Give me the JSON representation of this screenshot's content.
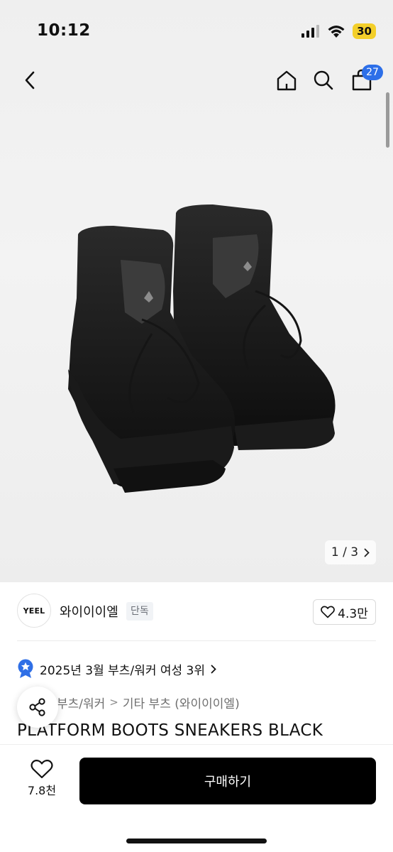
{
  "status_bar": {
    "time": "10:12",
    "battery": "30",
    "battery_color": "#f3cf2a"
  },
  "top_nav": {
    "icons": [
      "back-chevron-icon",
      "home-icon",
      "search-icon",
      "shopping-bag-icon"
    ],
    "cart_count": "27",
    "badge_color": "#2d6fe8"
  },
  "gallery": {
    "current": "1 / 3",
    "image_subject": "black high-top lace-up platform sneaker boots"
  },
  "brand": {
    "logo_text": "YEEL",
    "name": "와이이이엘",
    "badge": "단독",
    "likes": "4.3만"
  },
  "ranking": {
    "icon": "star-badge-icon",
    "text": "2025년 3월 부츠/워커 여성 3위"
  },
  "breadcrumb": {
    "items": [
      "부츠/워커",
      "기타 부츠 (와이이이엘)"
    ]
  },
  "product": {
    "title": "PLATFORM BOOTS SNEAKERS BLACK"
  },
  "bottom_bar": {
    "wish_count": "7.8천",
    "buy_label": "구매하기"
  }
}
